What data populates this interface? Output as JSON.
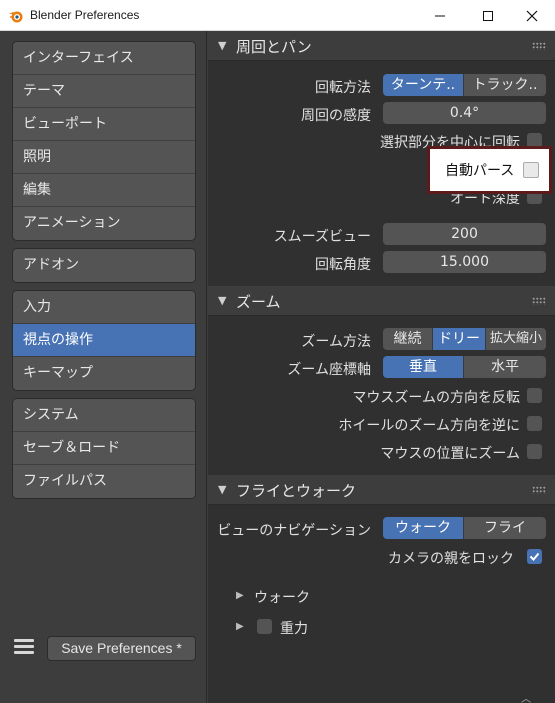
{
  "window": {
    "title": "Blender Preferences",
    "min_glyph": "—",
    "max_glyph": "☐",
    "close_glyph": "✕"
  },
  "sidebar": {
    "groups": [
      [
        "インターフェイス",
        "テーマ",
        "ビューポート",
        "照明",
        "編集",
        "アニメーション"
      ],
      [
        "アドオン"
      ],
      [
        "入力",
        "視点の操作",
        "キーマップ"
      ],
      [
        "システム",
        "セーブ＆ロード",
        "ファイルパス"
      ]
    ],
    "active": "視点の操作",
    "save_button": "Save Preferences *"
  },
  "orbit_pan": {
    "title": "周回とパン",
    "orbit_method_label": "回転方法",
    "orbit_method_options": [
      "ターンテ..",
      "トラック.."
    ],
    "orbit_method_selected": "ターンテ..",
    "orbit_sensitivity_label": "周回の感度",
    "orbit_sensitivity_value": "0.4°",
    "orbit_around_selection_label": "選択部分を中心に回転",
    "auto_perspective_label": "自動パース",
    "auto_depth_label": "オート深度",
    "smooth_view_label": "スムーズビュー",
    "smooth_view_value": "200",
    "rotation_angle_label": "回転角度",
    "rotation_angle_value": "15.000"
  },
  "zoom": {
    "title": "ズーム",
    "zoom_method_label": "ズーム方法",
    "zoom_method_options": [
      "継続",
      "ドリー",
      "拡大縮小"
    ],
    "zoom_method_selected": "ドリー",
    "zoom_axis_label": "ズーム座標軸",
    "zoom_axis_options": [
      "垂直",
      "水平"
    ],
    "zoom_axis_selected": "垂直",
    "invert_mouse_zoom_label": "マウスズームの方向を反転",
    "invert_wheel_zoom_label": "ホイールのズーム方向を逆に",
    "zoom_to_mouse_label": "マウスの位置にズーム"
  },
  "fly_walk": {
    "title": "フライとウォーク",
    "view_navigation_label": "ビューのナビゲーション",
    "view_navigation_options": [
      "ウォーク",
      "フライ"
    ],
    "view_navigation_selected": "ウォーク",
    "lock_camera_parent_label": "カメラの親をロック",
    "lock_camera_parent_checked": true,
    "walk_sub": "ウォーク",
    "gravity_sub": "重力"
  },
  "colors": {
    "accent": "#4772b3",
    "panel_bg": "#303030",
    "highlight_border": "#5c1a1a"
  }
}
